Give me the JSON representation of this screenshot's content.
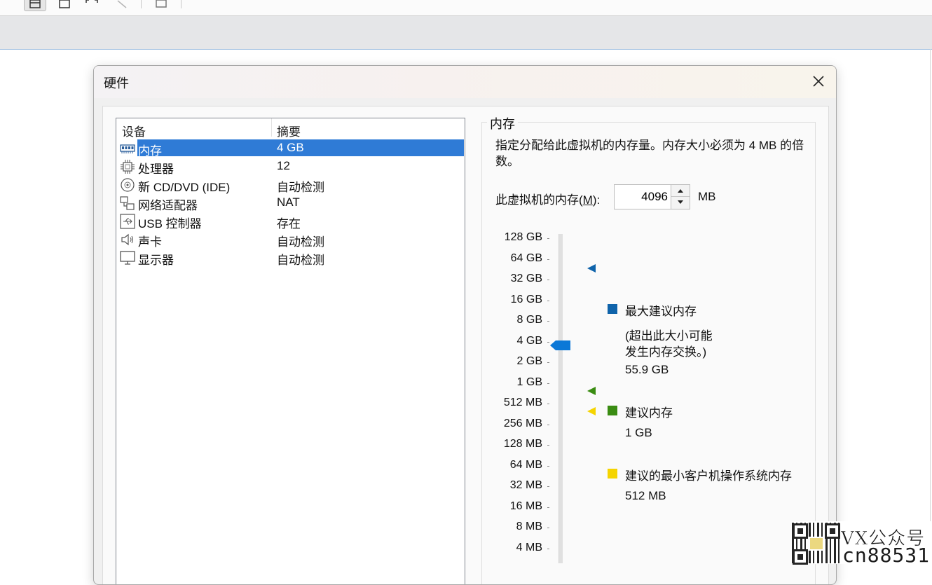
{
  "dialog": {
    "title": "硬件"
  },
  "device_list": {
    "headers": {
      "device": "设备",
      "summary": "摘要"
    },
    "rows": [
      {
        "icon": "memory-icon",
        "name": "内存",
        "summary": "4 GB",
        "selected": true
      },
      {
        "icon": "processor-icon",
        "name": "处理器",
        "summary": "12",
        "selected": false
      },
      {
        "icon": "cd-dvd-icon",
        "name": "新 CD/DVD (IDE)",
        "summary": "自动检测",
        "selected": false
      },
      {
        "icon": "network-adapter-icon",
        "name": "网络适配器",
        "summary": "NAT",
        "selected": false
      },
      {
        "icon": "usb-icon",
        "name": "USB 控制器",
        "summary": "存在",
        "selected": false
      },
      {
        "icon": "speaker-icon",
        "name": "声卡",
        "summary": "自动检测",
        "selected": false
      },
      {
        "icon": "monitor-icon",
        "name": "显示器",
        "summary": "自动检测",
        "selected": false
      }
    ]
  },
  "memory": {
    "group_title": "内存",
    "description": "指定分配给此虚拟机的内存量。内存大小必须为 4 MB 的倍数。",
    "input_label_prefix": "此虚拟机的内存(",
    "input_label_mnemonic": "M",
    "input_label_suffix": "):",
    "value": "4096",
    "unit": "MB",
    "scale_labels": [
      "128 GB",
      "64 GB",
      "32 GB",
      "16 GB",
      "8 GB",
      "4 GB",
      "2 GB",
      "1 GB",
      "512 MB",
      "256 MB",
      "128 MB",
      "64 MB",
      "32 MB",
      "16 MB",
      "8 MB",
      "4 MB"
    ],
    "slider_value": "4 GB",
    "legend": {
      "max": {
        "label": "最大建议内存",
        "note_line1": "(超出此大小可能",
        "note_line2": "发生内存交换。)",
        "value": "55.9 GB",
        "color": "#0f63aa"
      },
      "recommended": {
        "label": "建议内存",
        "value": "1 GB",
        "color": "#3a8c12"
      },
      "min_guest": {
        "label": "建议的最小客户机操作系统内存",
        "value": "512 MB",
        "color": "#f5d400"
      }
    }
  },
  "watermark": {
    "line1": "VX公众号",
    "line2": "cn88531"
  }
}
